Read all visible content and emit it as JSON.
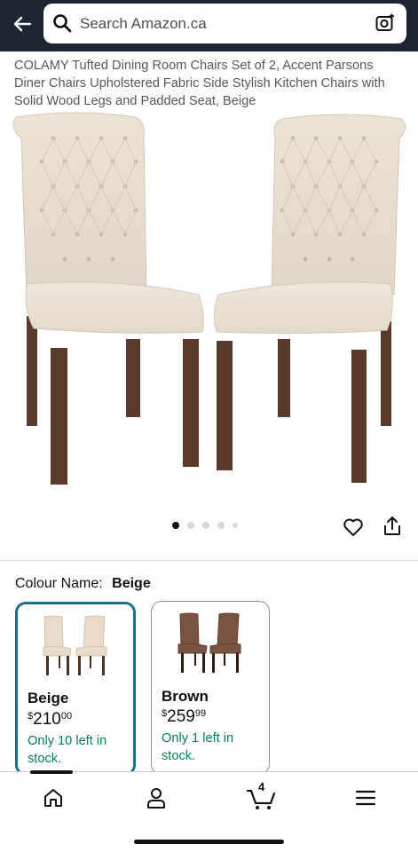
{
  "header": {
    "search_placeholder": "Search Amazon.ca"
  },
  "product": {
    "title": "COLAMY Tufted Dining Room Chairs Set of 2, Accent Parsons Diner Chairs Upholstered Fabric Side Stylish Kitchen Chairs with Solid Wood Legs and Padded Seat, Beige",
    "image_count": 5,
    "active_image_index": 1
  },
  "colour": {
    "label": "Colour Name:",
    "selected": "Beige",
    "options": [
      {
        "name": "Beige",
        "price_currency": "$",
        "price_whole": "210",
        "price_fraction": "00",
        "stock": "Only 10 left in stock.",
        "color": "#e9dccb"
      },
      {
        "name": "Brown",
        "price_currency": "$",
        "price_whole": "259",
        "price_fraction": "99",
        "stock": "Only 1 left in stock.",
        "color": "#7a5443"
      }
    ]
  },
  "nav": {
    "cart_count": "4"
  },
  "colors": {
    "header_bg": "#1d2630",
    "selected_border": "#1f6c8e",
    "stock_green": "#067d62"
  }
}
